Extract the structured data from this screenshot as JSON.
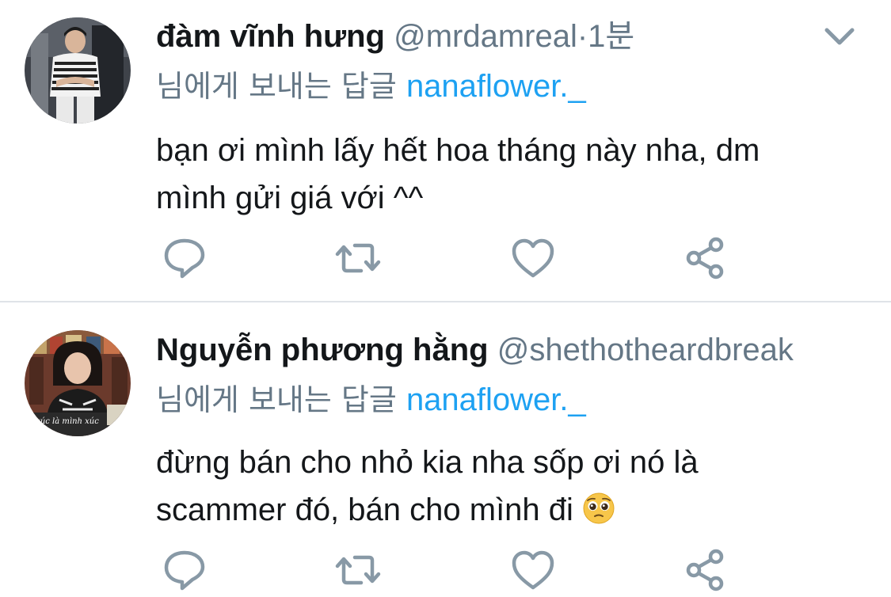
{
  "tweets": [
    {
      "name": "đàm vĩnh hưng",
      "handle": "@mrdamreal",
      "time": "·1분",
      "reply_prefix": "님에게 보내는 답글",
      "reply_to": "nanaflower._",
      "text_lines": [
        "bạn ơi mình lấy hết hoa tháng này nha, dm",
        "mình gửi giá với ^^"
      ],
      "avatar_icon": "avatar-photo-man"
    },
    {
      "name": "Nguyễn phương hằng",
      "handle": "@shethotheardbreak",
      "reply_prefix": "님에게 보내는 답글",
      "reply_to": "nanaflower._",
      "text_lines": [
        "đừng bán cho nhỏ kia nha sốp ơi nó là",
        "scammer đó, bán cho mình đi"
      ],
      "emoji": "pleading-face-emoji",
      "avatar_caption": "xúc là mình xúc",
      "avatar_icon": "avatar-photo-woman"
    }
  ],
  "colors": {
    "text": "#14171a",
    "secondary": "#657786",
    "link": "#1da1f2",
    "icon": "#8899a6",
    "divider": "#dfe3e8"
  },
  "icons": [
    "comment-icon",
    "retweet-icon",
    "like-icon",
    "share-icon",
    "chevron-down-icon"
  ]
}
